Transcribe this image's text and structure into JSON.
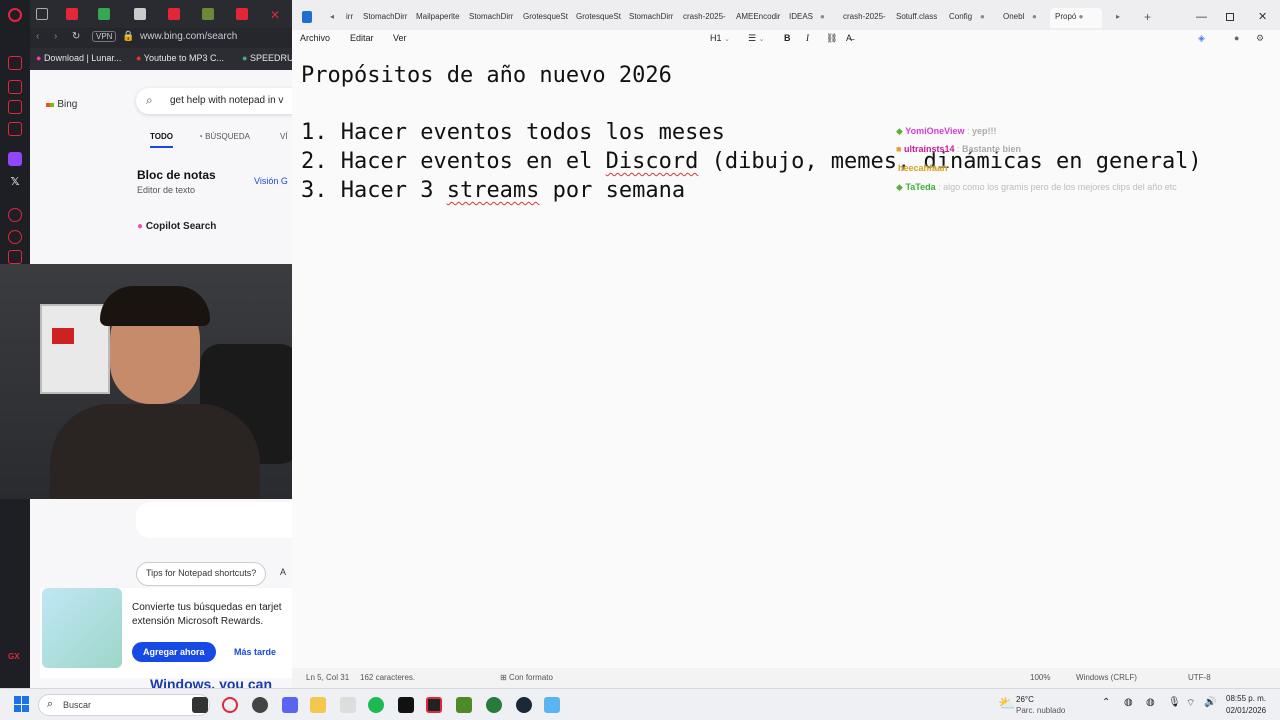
{
  "browser": {
    "url": "www.bing.com/search",
    "vpn_label": "VPN",
    "bookmarks": [
      "Download | Lunar...",
      "Youtube to MP3 C...",
      "SPEEDRU"
    ]
  },
  "bing": {
    "logo_label": "Bing",
    "search_query": "get help with notepad in v",
    "tabs": [
      "TODO",
      "BÚSQUEDA",
      "VÍ"
    ],
    "result_title": "Bloc de notas",
    "result_subtitle": "Editor de texto",
    "vision_label": "Visión G",
    "copilot_label": "Copilot Search",
    "tip_chip": "Tips for Notepad shortcuts?",
    "tip_chip_extra": "A",
    "rewards_text_1": "Convierte tus búsquedas en tarjet",
    "rewards_text_2": "extensión Microsoft Rewards.",
    "rewards_primary": "Agregar ahora",
    "rewards_secondary": "Más tarde",
    "footer_heading": "Windows, you can"
  },
  "notepad": {
    "tabs": [
      "irr",
      "StomachDirr",
      "Mailpaperlte",
      "StomachDirr",
      "GrotesqueSt",
      "GrotesqueSt",
      "StomachDirr",
      "crash-2025-",
      "AMEEncodir",
      "IDEAS",
      "crash-2025-",
      "Sotuff.class",
      "Config",
      "Onebl",
      "Propó"
    ],
    "menu": [
      "Archivo",
      "Editar",
      "Ver"
    ],
    "heading_level": "H1",
    "lines": [
      "Propósitos de año nuevo 2026",
      "1. Hacer eventos todos los meses",
      "2. Hacer eventos en el ",
      "Discord",
      " (dibujo, memes, dinámicas en general)",
      "3. Hacer 3 ",
      "streams",
      " por semana"
    ],
    "status": {
      "position": "Ln 5, Col 31",
      "chars": "162 caracteres.",
      "format": "Con formato",
      "zoom": "100%",
      "line_ending": "Windows (CRLF)",
      "encoding": "UTF-8"
    }
  },
  "chat": [
    {
      "name": "YomiOneView",
      "message": "yep!!!"
    },
    {
      "name": "ultrainsts14",
      "message": "Bastante bien"
    },
    {
      "name": "heecahfaan",
      "message": ""
    },
    {
      "name": "TaTeda",
      "message": "algo como los gramis pero de los mejores clips del año etc"
    }
  ],
  "taskbar": {
    "search_placeholder": "Buscar",
    "weather_temp": "26°C",
    "weather_desc": "Parc. nublado",
    "time": "08:55 p. m.",
    "date": "02/01/2026"
  }
}
